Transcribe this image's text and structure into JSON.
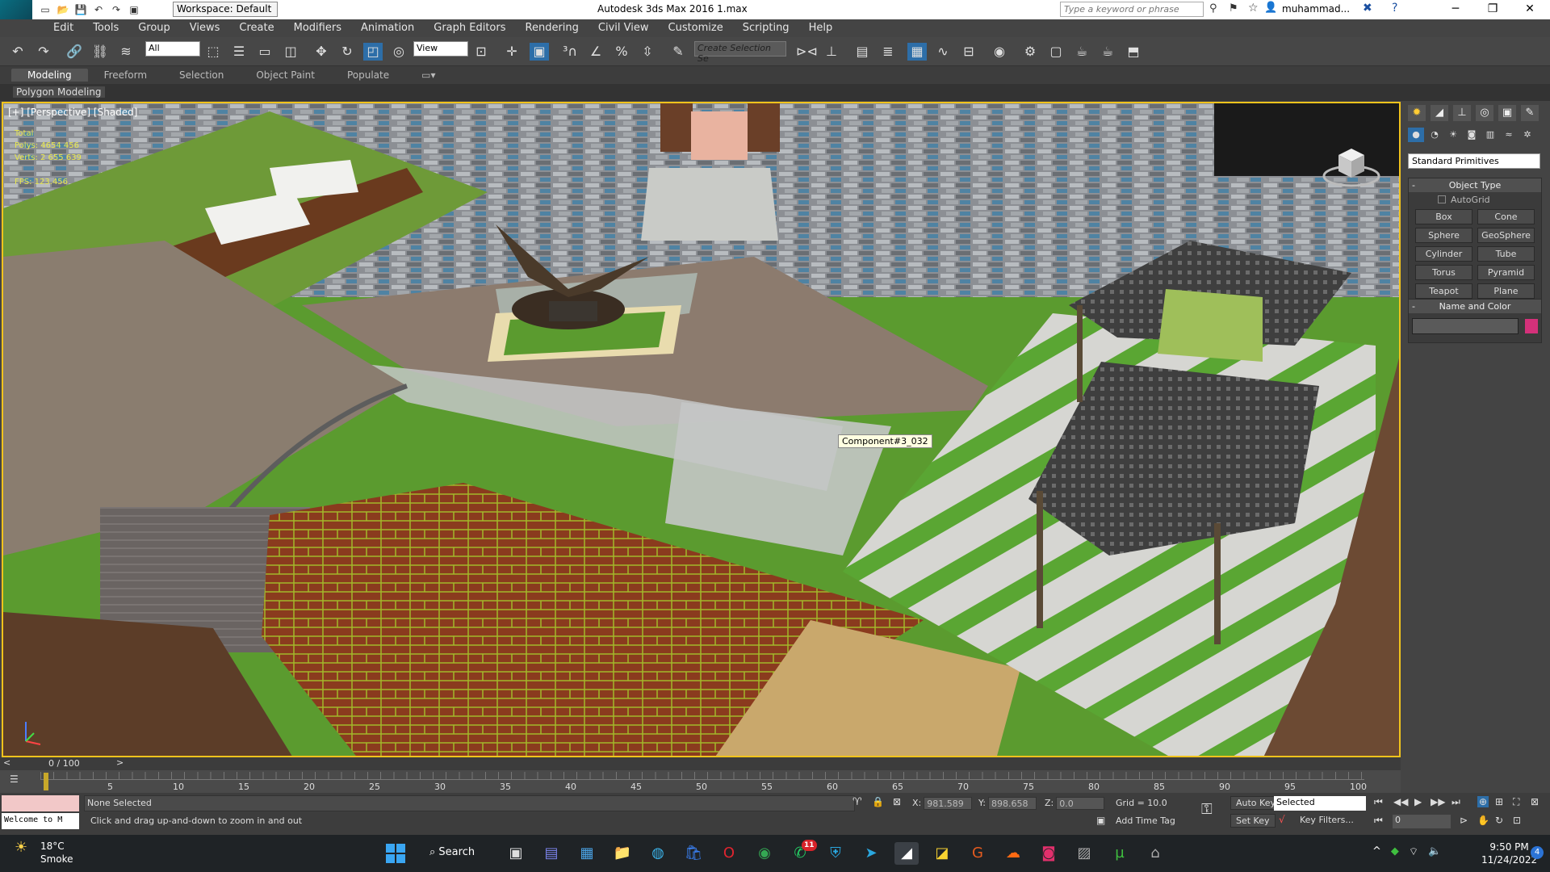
{
  "titlebar": {
    "workspace": "Workspace: Default",
    "title": "Autodesk 3ds Max 2016      1.max",
    "search_placeholder": "Type a keyword or phrase",
    "user": "muhammad...",
    "logo": "MAX"
  },
  "menu": [
    "Edit",
    "Tools",
    "Group",
    "Views",
    "Create",
    "Modifiers",
    "Animation",
    "Graph Editors",
    "Rendering",
    "Civil View",
    "Customize",
    "Scripting",
    "Help"
  ],
  "toolbar": {
    "selection_filter": "All",
    "ref_coord": "View",
    "named_selection": "Create Selection Se"
  },
  "ribbon": {
    "tabs": [
      "Modeling",
      "Freeform",
      "Selection",
      "Object Paint",
      "Populate"
    ],
    "panel": "Polygon Modeling"
  },
  "viewport": {
    "label": "[+] [Perspective] [Shaded]",
    "stats": [
      "Total",
      "Polys: 4654 456",
      "Verts: 2 655 639",
      "",
      "FPS: 123.456"
    ],
    "tooltip": "Component#3_032"
  },
  "command_panel": {
    "category": "Standard Primitives",
    "object_type_title": "Object Type",
    "autogrid": "AutoGrid",
    "primitives": [
      "Box",
      "Cone",
      "Sphere",
      "GeoSphere",
      "Cylinder",
      "Tube",
      "Torus",
      "Pyramid",
      "Teapot",
      "Plane"
    ],
    "name_color_title": "Name and Color",
    "swatch_color": "#d4317a"
  },
  "timeline": {
    "frame_label": "0 / 100",
    "ticks": [
      "5",
      "10",
      "15",
      "20",
      "25",
      "30",
      "35",
      "40",
      "45",
      "50",
      "55",
      "60",
      "65",
      "70",
      "75",
      "80",
      "85",
      "90",
      "95",
      "100"
    ]
  },
  "status": {
    "maxscript": "Welcome to M",
    "selection": "None Selected",
    "prompt": "Click and drag up-and-down to zoom in and out",
    "x": "981.589",
    "y": "898.658",
    "z": "0.0",
    "grid": "Grid = 10.0",
    "add_time_tag": "Add Time Tag",
    "auto_key": "Auto Key",
    "set_key": "Set Key",
    "selected_dd": "Selected",
    "key_filters": "Key Filters...",
    "frame": "0"
  },
  "taskbar": {
    "temp": "18°C",
    "weather": "Smoke",
    "search": "Search",
    "whatsapp_badge": "11",
    "time": "9:50 PM",
    "date": "11/24/2022"
  }
}
